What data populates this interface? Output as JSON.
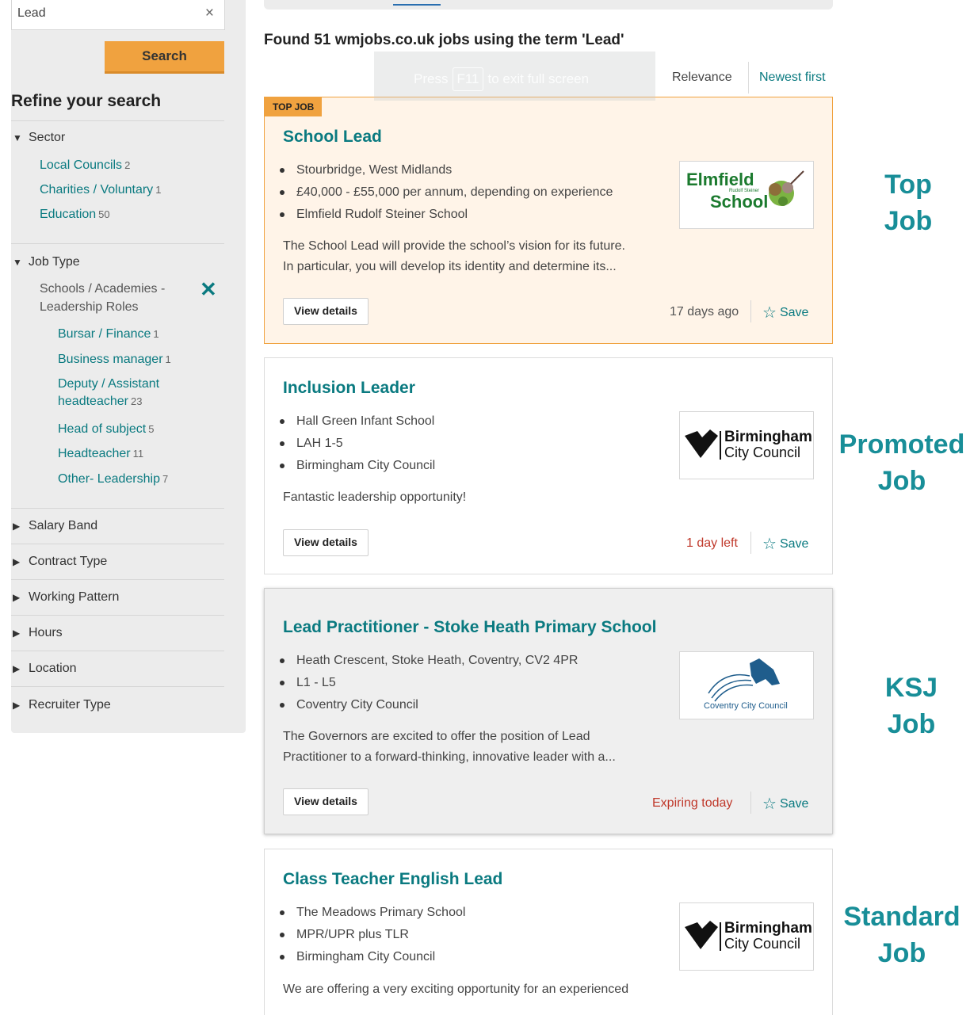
{
  "search": {
    "value": "Lead",
    "clear_icon": "×",
    "button_label": "Search"
  },
  "refine": {
    "title": "Refine your search",
    "sector": {
      "heading": "Sector",
      "items": [
        {
          "label": "Local Councils",
          "count": "2"
        },
        {
          "label": "Charities / Voluntary",
          "count": "1"
        },
        {
          "label": "Education",
          "count": "50"
        }
      ]
    },
    "job_type": {
      "heading": "Job Type",
      "selected_line1": "Schools / Academies -",
      "selected_line2": "Leadership Roles",
      "remove_icon": "✕",
      "items": [
        {
          "label": "Bursar / Finance",
          "count": "1"
        },
        {
          "label": "Business manager",
          "count": "1"
        },
        {
          "label": "Deputy / Assistant",
          "count": ""
        },
        {
          "label": "headteacher",
          "count": "23"
        },
        {
          "label": "Head of subject",
          "count": "5"
        },
        {
          "label": "Headteacher",
          "count": "11"
        },
        {
          "label": "Other- Leadership",
          "count": "7"
        }
      ]
    },
    "collapsed": [
      "Salary Band",
      "Contract Type",
      "Working Pattern",
      "Hours",
      "Location",
      "Recruiter Type"
    ]
  },
  "results": {
    "title": "Found 51 wmjobs.co.uk jobs using the term 'Lead'",
    "sort_relevance": "Relevance",
    "sort_newest": "Newest first"
  },
  "fullscreen_notice": {
    "press": "Press",
    "key": "F11",
    "rest": "to exit full screen"
  },
  "jobs": [
    {
      "badge": "TOP JOB",
      "title": "School Lead",
      "facts": [
        "Stourbridge, West Midlands",
        "£40,000 - £55,000 per annum, depending on experience",
        "Elmfield Rudolf Steiner School"
      ],
      "desc1": "The School Lead will provide the school’s vision for its future.",
      "desc2": "In particular, you will develop its identity and determine its...",
      "view": "View details",
      "meta": "17 days ago",
      "save": "Save",
      "logo": {
        "line1": "Elmfield",
        "line2": "School",
        "small": "Rudolf Steiner"
      }
    },
    {
      "title": "Inclusion Leader",
      "facts": [
        "Hall Green Infant School",
        "LAH 1-5",
        "Birmingham City Council"
      ],
      "desc1": "Fantastic leadership opportunity!",
      "view": "View details",
      "meta": "1 day left",
      "save": "Save",
      "logo": {
        "line1": "Birmingham",
        "line2": "City Council"
      }
    },
    {
      "title": "Lead Practitioner - Stoke Heath Primary School",
      "facts": [
        "Heath Crescent, Stoke Heath, Coventry, CV2 4PR",
        "L1 - L5",
        "Coventry City Council"
      ],
      "desc1": "The Governors are excited to offer the position of Lead",
      "desc2": "Practitioner to a forward-thinking, innovative leader with a...",
      "view": "View details",
      "meta": "Expiring today",
      "save": "Save",
      "logo": {
        "line1": "Coventry",
        "line2": "City Council"
      }
    },
    {
      "title": "Class Teacher English Lead",
      "facts": [
        "The Meadows Primary School",
        "MPR/UPR plus TLR",
        "Birmingham City Council"
      ],
      "desc1": "We are offering a very exciting opportunity for an experienced",
      "logo": {
        "line1": "Birmingham",
        "line2": "City Council"
      }
    }
  ],
  "annotations": {
    "top": [
      "Top",
      "Job"
    ],
    "promoted": [
      "Promoted",
      "Job"
    ],
    "ksj": [
      "KSJ",
      "Job"
    ],
    "standard": [
      "Standard",
      "Job"
    ]
  },
  "colors": {
    "teal": "#0a7a80",
    "orange": "#f0a23f",
    "urgent_red": "#c0392b",
    "annotation": "#188e98"
  }
}
